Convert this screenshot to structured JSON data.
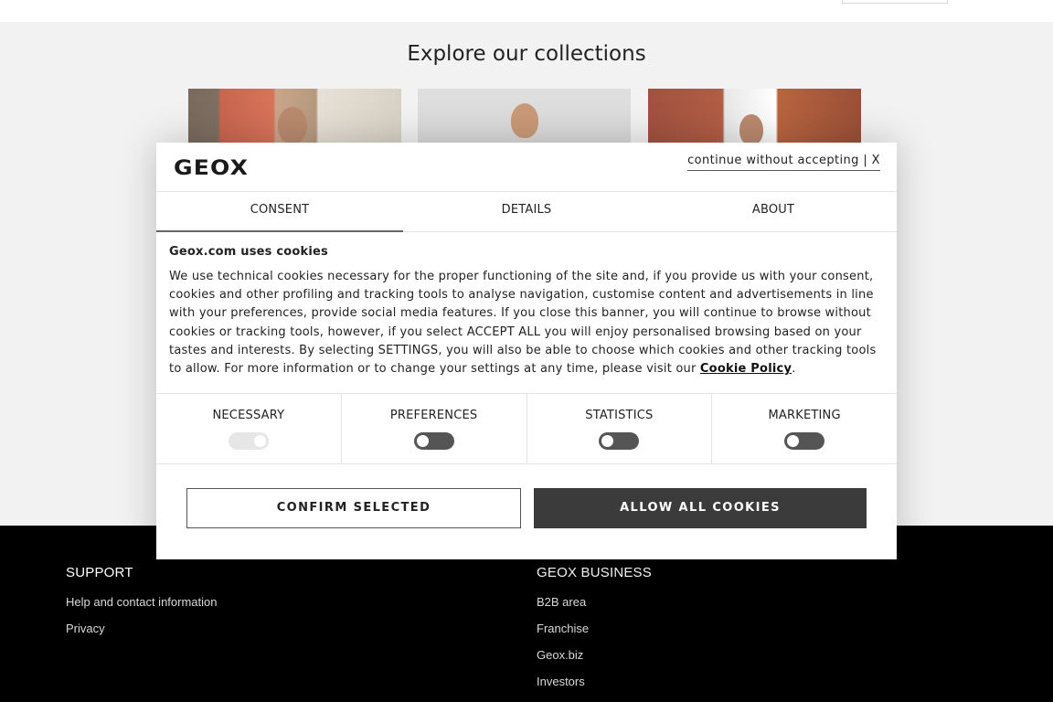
{
  "page": {
    "section_title": "Explore our collections"
  },
  "footer": {
    "support": {
      "heading": "SUPPORT",
      "links": [
        "Help and contact information",
        "Privacy"
      ]
    },
    "business": {
      "heading": "GEOX BUSINESS",
      "links": [
        "B2B area",
        "Franchise",
        "Geox.biz",
        "Investors"
      ]
    }
  },
  "cookie_modal": {
    "brand": "GEOX",
    "dismiss_label": "continue without accepting | X",
    "tabs": [
      {
        "label": "CONSENT",
        "active": true
      },
      {
        "label": "DETAILS",
        "active": false
      },
      {
        "label": "ABOUT",
        "active": false
      }
    ],
    "title": "Geox.com uses cookies",
    "body_text": "We use technical cookies necessary for the proper functioning of the site and, if you provide us with your consent, cookies and other profiling and tracking tools to analyse navigation, customise content and advertisements in line with your preferences, provide social media features. If you close this banner, you will continue to browse without cookies or tracking tools, however, if you select ACCEPT ALL you will enjoy personalised browsing based on your tastes and interests. By selecting SETTINGS, you will also be able to choose which cookies and other tracking tools to allow. For more information or to change your settings at any time, please visit our ",
    "policy_link": "Cookie Policy",
    "body_end": ".",
    "categories": [
      {
        "label": "NECESSARY",
        "enabled": true,
        "locked": true
      },
      {
        "label": "PREFERENCES",
        "enabled": false,
        "locked": false
      },
      {
        "label": "STATISTICS",
        "enabled": false,
        "locked": false
      },
      {
        "label": "MARKETING",
        "enabled": false,
        "locked": false
      }
    ],
    "confirm_label": "CONFIRM SELECTED",
    "allow_label": "ALLOW ALL COOKIES"
  }
}
